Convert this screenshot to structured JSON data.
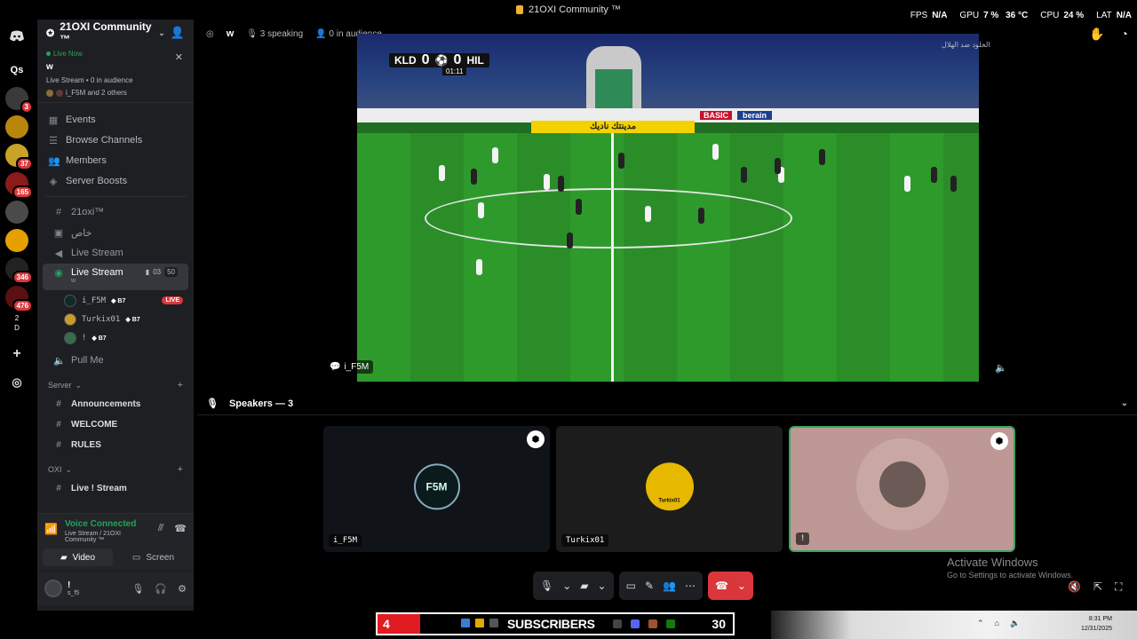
{
  "window": {
    "title": "21OXI Community ™"
  },
  "overlay": {
    "fps_label": "FPS",
    "fps": "N/A",
    "gpu_label": "GPU",
    "gpu": "7 %",
    "temp": "36 °C",
    "cpu_label": "CPU",
    "cpu": "24 %",
    "lat_label": "LAT",
    "lat": "N/A"
  },
  "rail": {
    "dm_label": "Qs",
    "servers": [
      {
        "badge": "3",
        "color": "#3a3a3a"
      },
      {
        "badge": "",
        "color": "#b8860b"
      },
      {
        "badge": "37",
        "color": "#c9a227"
      },
      {
        "badge": "165",
        "color": "#8b1a1a"
      },
      {
        "badge": "",
        "color": "#4a4a4a"
      },
      {
        "badge": "",
        "color": "#e6a100"
      },
      {
        "badge": "346",
        "color": "#222"
      },
      {
        "badge": "476",
        "color": "#5a1010"
      }
    ],
    "folder_top": "2",
    "folder_bottom": "D"
  },
  "sidebar": {
    "server_name": "21OXI Community ™",
    "live_now": "Live Now",
    "live_title": "w",
    "live_meta_type": "Live Stream",
    "live_meta_audience": "0 in audience",
    "live_viewers": "i_F5M and 2 others",
    "nav": [
      {
        "label": "Events",
        "icon": "calendar-icon"
      },
      {
        "label": "Browse Channels",
        "icon": "list-icon"
      },
      {
        "label": "Members",
        "icon": "members-icon"
      },
      {
        "label": "Server Boosts",
        "icon": "boost-icon"
      }
    ],
    "channels_top": [
      {
        "label": "21oxi™",
        "icon": "#"
      },
      {
        "label": "خاص",
        "icon": "▣"
      },
      {
        "label": "Live Stream",
        "icon": "◀"
      }
    ],
    "active_channel": {
      "label": "Live Stream",
      "sub": "w",
      "cams": "03",
      "limit": "50"
    },
    "members": [
      {
        "name": "i_F5M",
        "tag": "B7",
        "live": "LIVE"
      },
      {
        "name": "Turkix01",
        "tag": "B7",
        "live": ""
      },
      {
        "name": "!",
        "tag": "B7",
        "live": ""
      }
    ],
    "pull_me": "Pull Me",
    "category_server": "Server",
    "server_channels": [
      "Announcements",
      "WELCOME",
      "RULES"
    ],
    "category_oxi": "OXI",
    "oxi_channels": [
      "Live ! Stream"
    ]
  },
  "voice": {
    "status": "Voice Connected",
    "sub": "Live Stream / 21OXI Community ™",
    "video_label": "Video",
    "screen_label": "Screen"
  },
  "user": {
    "name": "!",
    "tag": "s_f5"
  },
  "header": {
    "channel": "w",
    "speaking": "3 speaking",
    "audience": "0 in audience"
  },
  "stream": {
    "home": "KLD",
    "home_score": "0",
    "away_score": "0",
    "away": "HIL",
    "clock": "01:11",
    "board_text": "مدينتك ناديك",
    "board_basic": "BASIC",
    "board_berain": "berain",
    "streamer": "i_F5M",
    "corner_text": "الخلود ضد الهلال"
  },
  "speakers": {
    "heading": "Speakers — 3",
    "tiles": [
      {
        "name": "i_F5M",
        "logo": "F5M",
        "bg": "#101418"
      },
      {
        "name": "Turkix01",
        "logo": "Turkix01",
        "bg": "#1c1c1c"
      },
      {
        "name": "!",
        "logo": "",
        "bg": "#bd9895"
      }
    ]
  },
  "activation": {
    "title": "Activate Windows",
    "sub": "Go to Settings to activate Windows."
  },
  "taskbar": {
    "sub_count_left": "4",
    "sub_label": "SUBSCRIBERS",
    "sub_count_right": "30",
    "time": "8:31 PM",
    "date": "12/31/2025"
  }
}
